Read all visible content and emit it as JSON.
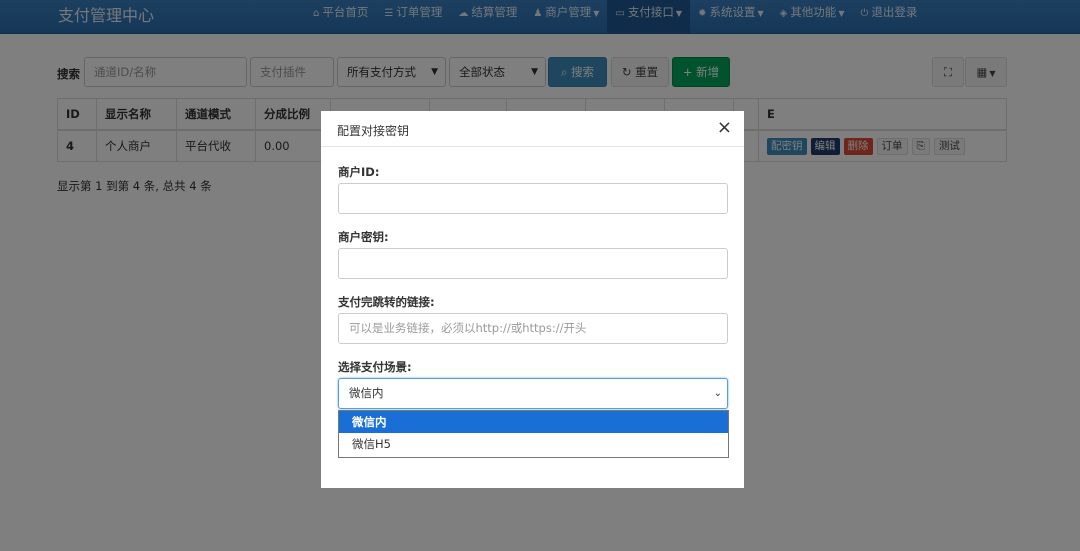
{
  "app": {
    "title": "支付管理中心"
  },
  "nav": [
    {
      "icon": "home-icon",
      "glyph": "⌂",
      "label": "平台首页",
      "caret": false
    },
    {
      "icon": "list-icon",
      "glyph": "☰",
      "label": "订单管理",
      "caret": false
    },
    {
      "icon": "cloud-icon",
      "glyph": "☁",
      "label": "结算管理",
      "caret": false
    },
    {
      "icon": "user-icon",
      "glyph": "♟",
      "label": "商户管理",
      "caret": true
    },
    {
      "icon": "card-icon",
      "glyph": "▭",
      "label": "支付接口",
      "caret": true,
      "active": true
    },
    {
      "icon": "gear-icon",
      "glyph": "✹",
      "label": "系统设置",
      "caret": true
    },
    {
      "icon": "cube-icon",
      "glyph": "◈",
      "label": "其他功能",
      "caret": true
    },
    {
      "icon": "power-icon",
      "glyph": "⏻",
      "label": "退出登录",
      "caret": false
    }
  ],
  "toolbar": {
    "search_label": "搜索",
    "channel_placeholder": "通道ID/名称",
    "plugin_placeholder": "支付插件",
    "paytype_value": "所有支付方式",
    "status_value": "全部状态",
    "search_button": "搜索",
    "reset_button": "重置",
    "add_button": "新增"
  },
  "table": {
    "headers": [
      "ID",
      "显示名称",
      "通道模式",
      "分成比例",
      "",
      "",
      "",
      "",
      "",
      "",
      "E"
    ],
    "row": {
      "id": "4",
      "name": "个人商户",
      "mode": "平台代收",
      "ratio": "0.00"
    },
    "actions": {
      "key": "配密钥",
      "edit": "编辑",
      "delete": "删除",
      "order": "订单",
      "copy": "⎘",
      "test": "测试"
    }
  },
  "pagination_info": "显示第 1 到第 4 条, 总共 4 条",
  "modal": {
    "title": "配置对接密钥",
    "close": "×",
    "merchant_id_label": "商户ID:",
    "merchant_id_value": "",
    "merchant_key_label": "商户密钥:",
    "merchant_key_value": "",
    "return_url_label": "支付完跳转的链接:",
    "return_url_placeholder": "可以是业务链接，必须以http://或https://开头",
    "scene_label": "选择支付场景:",
    "scene_value": "微信内",
    "scene_options": [
      "微信内",
      "微信H5"
    ]
  }
}
